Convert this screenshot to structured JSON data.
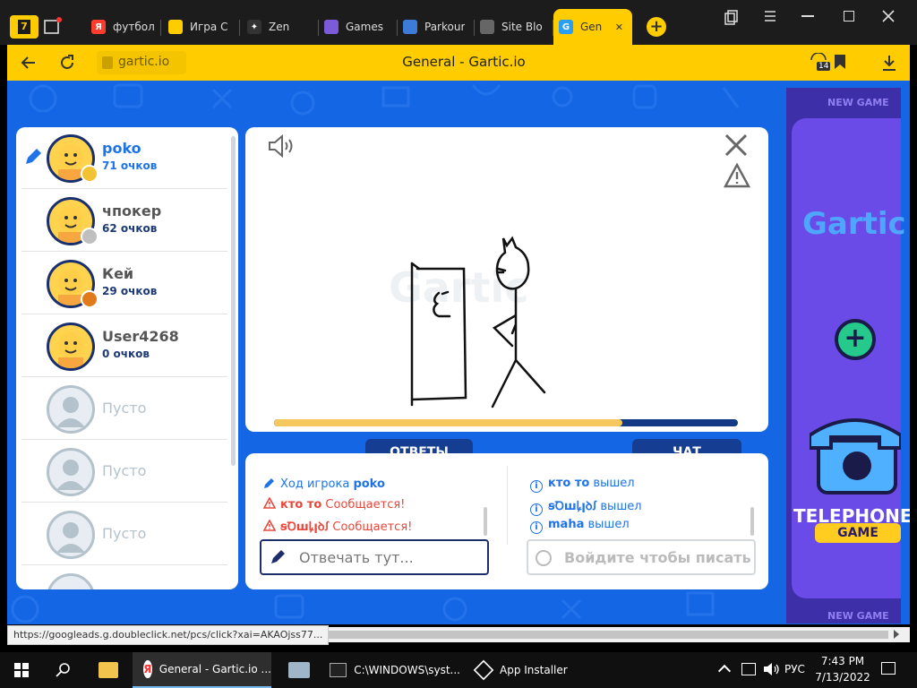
{
  "browser": {
    "tab_counter": "7",
    "tabs": [
      {
        "label": "футбол",
        "fav": "Я",
        "color": "#ff3d2e"
      },
      {
        "label": "Игра C",
        "fav": "",
        "color": "#ffcc00"
      },
      {
        "label": "Zen",
        "fav": "✦",
        "color": "#333333"
      },
      {
        "label": "Games",
        "fav": "",
        "color": "#7b5bd9"
      },
      {
        "label": "Parkour",
        "fav": "",
        "color": "#3d7bd9"
      },
      {
        "label": "Site Blo",
        "fav": "",
        "color": "#666666"
      },
      {
        "label": "Gen",
        "fav": "G",
        "color": "#2a9df4"
      }
    ],
    "domain": "gartic.io",
    "page_title": "General - Gartic.io",
    "downloads_count": "14",
    "status_url": "https://googleads.g.doubleclick.net/pcs/click?xai=AKAOjss77..."
  },
  "players": [
    {
      "name": "poko",
      "score": "71 очков",
      "active": true,
      "badge": "#f1c232"
    },
    {
      "name": "чпокер",
      "score": "62 очков",
      "active": false,
      "badge": "#bfbfbf"
    },
    {
      "name": "Кей",
      "score": "29 очков",
      "active": false,
      "badge": "#e07b1c"
    },
    {
      "name": "User4268",
      "score": "0 очков",
      "active": false,
      "badge": ""
    }
  ],
  "empty_slots": [
    "Пусто",
    "Пусто",
    "Пусто"
  ],
  "game": {
    "timer_progress": 0.75,
    "answers_tab": "ОТВЕТЫ",
    "chat_tab": "ЧАТ",
    "answers": [
      {
        "prefix": "Ход игрока",
        "name": "poko",
        "type": "turn"
      },
      {
        "prefix": "кто то",
        "name": "Сообщается!",
        "type": "warn"
      },
      {
        "prefix": "ꞩꝹꟺꝲꞁꝺꭍ",
        "name": "Сообщается!",
        "type": "warn"
      }
    ],
    "chat": [
      {
        "name": "кто то",
        "text": "вышел"
      },
      {
        "name": "ꞩꝹꟺꝲꞁꝺꭍ",
        "text": "вышел"
      },
      {
        "name": "maha",
        "text": "вышел"
      }
    ],
    "answer_placeholder": "Отвечать тут...",
    "chat_placeholder": "Войдите чтобы писать в ч"
  },
  "ad": {
    "new_game_top": "NEW GAME",
    "logo": "Gartic",
    "title": "TELEPHONE",
    "subtitle": "GAME",
    "new_game_bottom": "NEW GAME"
  },
  "taskbar": {
    "items": [
      {
        "label": "General - Gartic.io ..."
      },
      {
        "label": "C:\\WINDOWS\\syst..."
      },
      {
        "label": "App Installer"
      }
    ],
    "lang": "РУС",
    "time": "7:43 PM",
    "date": "7/13/2022"
  }
}
